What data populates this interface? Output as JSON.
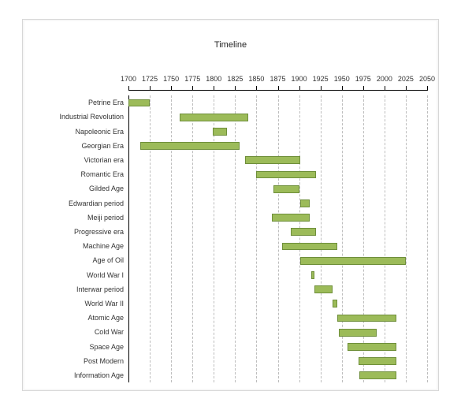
{
  "chart_data": {
    "type": "bar",
    "orientation": "horizontal-range",
    "title": "Timeline",
    "xlabel": "",
    "ylabel": "",
    "x_ticks": [
      1700,
      1725,
      1750,
      1775,
      1800,
      1825,
      1850,
      1875,
      1900,
      1925,
      1950,
      1975,
      2000,
      2025,
      2050
    ],
    "x_range": [
      1700,
      2050
    ],
    "series": [
      {
        "name": "Petrine Era",
        "start": 1700,
        "end": 1725
      },
      {
        "name": "Industrial Revolution",
        "start": 1760,
        "end": 1840
      },
      {
        "name": "Napoleonic Era",
        "start": 1799,
        "end": 1815
      },
      {
        "name": "Georgian Era",
        "start": 1714,
        "end": 1830
      },
      {
        "name": "Victorian era",
        "start": 1837,
        "end": 1901
      },
      {
        "name": "Romantic Era",
        "start": 1850,
        "end": 1920
      },
      {
        "name": "Gilded Age",
        "start": 1870,
        "end": 1900
      },
      {
        "name": "Edwardian period",
        "start": 1901,
        "end": 1912
      },
      {
        "name": "Meiji period",
        "start": 1868,
        "end": 1912
      },
      {
        "name": "Progressive era",
        "start": 1890,
        "end": 1920
      },
      {
        "name": "Machine Age",
        "start": 1880,
        "end": 1945
      },
      {
        "name": "Age of Oil",
        "start": 1901,
        "end": 2025
      },
      {
        "name": "World War I",
        "start": 1914,
        "end": 1918
      },
      {
        "name": "Interwar period",
        "start": 1918,
        "end": 1939
      },
      {
        "name": "World War II",
        "start": 1939,
        "end": 1945
      },
      {
        "name": "Atomic Age",
        "start": 1945,
        "end": 2014
      },
      {
        "name": "Cold War",
        "start": 1947,
        "end": 1991
      },
      {
        "name": "Space Age",
        "start": 1957,
        "end": 2014
      },
      {
        "name": "Post Modern",
        "start": 1970,
        "end": 2014
      },
      {
        "name": "Information Age",
        "start": 1971,
        "end": 2014
      }
    ],
    "bar_color": "#9cbb59",
    "grid": {
      "vertical": true,
      "style": "dashed"
    }
  }
}
